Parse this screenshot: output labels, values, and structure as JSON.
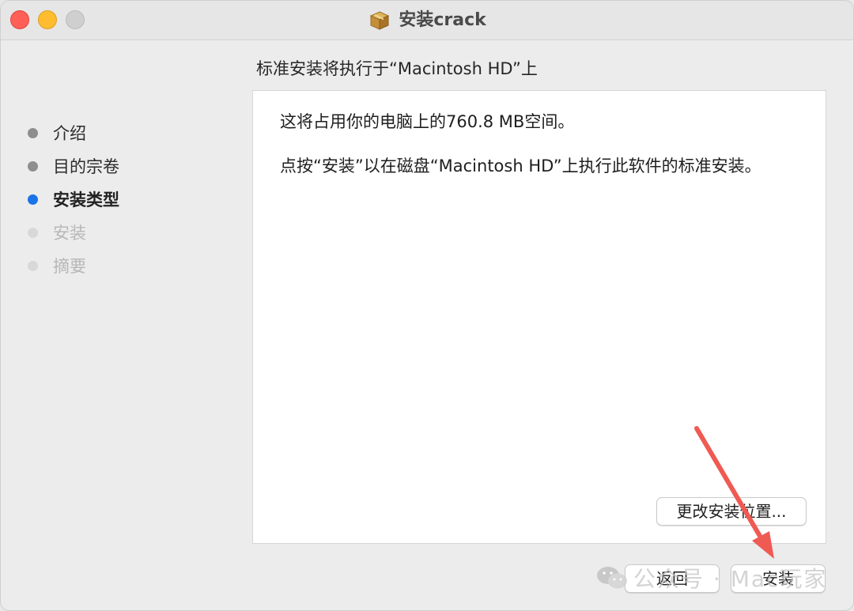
{
  "window": {
    "title": "安装crack",
    "title_icon": "package-icon"
  },
  "sidebar": {
    "steps": [
      {
        "label": "介绍",
        "state": "done"
      },
      {
        "label": "目的宗卷",
        "state": "done"
      },
      {
        "label": "安装类型",
        "state": "current"
      },
      {
        "label": "安装",
        "state": "future"
      },
      {
        "label": "摘要",
        "state": "future"
      }
    ]
  },
  "main": {
    "heading": "标准安装将执行于“Macintosh HD”上",
    "paragraph1": "这将占用你的电脑上的760.8 MB空间。",
    "paragraph2": "点按“安装”以在磁盘“Macintosh HD”上执行此软件的标准安装。",
    "change_location_label": "更改安装位置..."
  },
  "footer": {
    "back_label": "返回",
    "install_label": "安装"
  },
  "watermark": {
    "text": "公众号 · Mac玩家"
  },
  "colors": {
    "accent": "#1a73e8",
    "annotation_arrow": "#ef5a52",
    "close": "#fe5f57",
    "minimize": "#febc2e",
    "zoom": "#cfcfcf"
  }
}
